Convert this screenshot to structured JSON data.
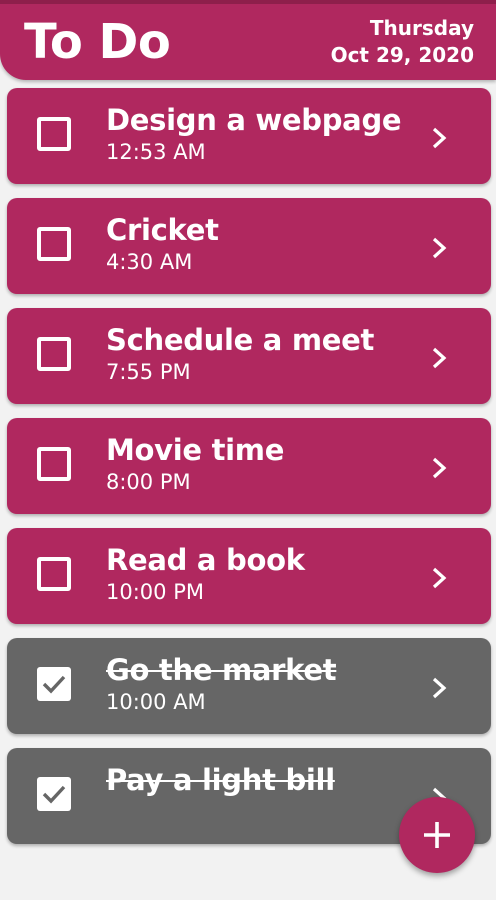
{
  "header": {
    "title": "To Do",
    "day": "Thursday",
    "date": "Oct 29, 2020"
  },
  "tasks": [
    {
      "name": "Design a webpage",
      "time": "12:53 AM",
      "completed": false
    },
    {
      "name": "Cricket",
      "time": "4:30 AM",
      "completed": false
    },
    {
      "name": "Schedule a meet",
      "time": "7:55 PM",
      "completed": false
    },
    {
      "name": "Movie time",
      "time": "8:00 PM",
      "completed": false
    },
    {
      "name": "Read a book",
      "time": "10:00 PM",
      "completed": false
    },
    {
      "name": "Go the market",
      "time": "10:00 AM",
      "completed": true
    },
    {
      "name": "Pay a light bill",
      "time": "",
      "completed": true
    }
  ],
  "fab": {
    "icon": "plus-icon"
  },
  "colors": {
    "accent": "#b0285f",
    "completed": "#666666",
    "background": "#f2f2f2"
  }
}
